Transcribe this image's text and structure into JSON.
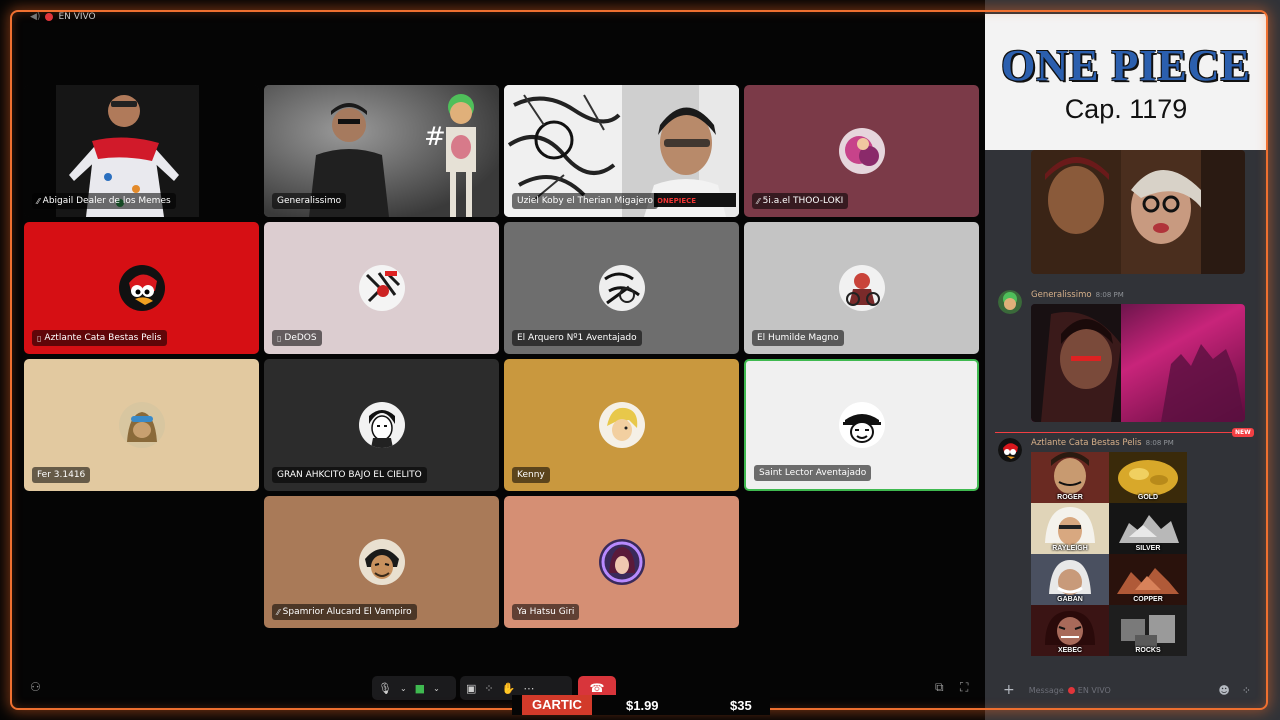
{
  "live_indicator": "EN VIVO",
  "tiles": [
    {
      "name": "Abigail Dealer de los Memes",
      "icon": "mute-slash-icon"
    },
    {
      "name": "Generalissimo",
      "icon": ""
    },
    {
      "name": "Uziel Koby el Therian Migajero",
      "icon": ""
    },
    {
      "name": "5i.a.el THOO-LOKI",
      "icon": "mute-slash-icon"
    },
    {
      "name": "Aztlante Cata Bestas Pelis",
      "icon": "phone-icon"
    },
    {
      "name": "DeDOS",
      "icon": "phone-icon"
    },
    {
      "name": "El Arquero Nº1 Aventajado",
      "icon": ""
    },
    {
      "name": "El Humilde Magno",
      "icon": ""
    },
    {
      "name": "Fer 3.1416",
      "icon": ""
    },
    {
      "name": "GRAN AHKCITO BAJO EL CIELITO",
      "icon": ""
    },
    {
      "name": "Kenny",
      "icon": ""
    },
    {
      "name": "Saint Lector Aventajado",
      "icon": ""
    },
    {
      "name": "Spamrior Alucard El Vampiro",
      "icon": "mute-slash-icon"
    },
    {
      "name": "Ya Hatsu Giri",
      "icon": ""
    }
  ],
  "overlay": {
    "logo_text": "ONE PIECE",
    "chapter": "Cap. 1179"
  },
  "ticker": {
    "tag": "GARTIC",
    "price1": "$1.99",
    "price2": "$35"
  },
  "chat": {
    "messages": [
      {
        "author": "Generalissimo",
        "time": "8:08 PM"
      },
      {
        "author": "Aztlante Cata Bestas Pelis",
        "time": "8:08 PM"
      }
    ],
    "new_badge": "NEW",
    "grid_labels": [
      "ROGER",
      "GOLD",
      "RAYLEIGH",
      "SILVER",
      "GABAN",
      "COPPER",
      "XEBEC",
      "ROCKS"
    ],
    "input_placeholder": "Message",
    "input_channel": "EN VIVO"
  },
  "colors": {
    "accent_border": "#f07030",
    "hangup": "#d8353b",
    "speaking": "#3fb950",
    "discord_bg": "#313338"
  }
}
